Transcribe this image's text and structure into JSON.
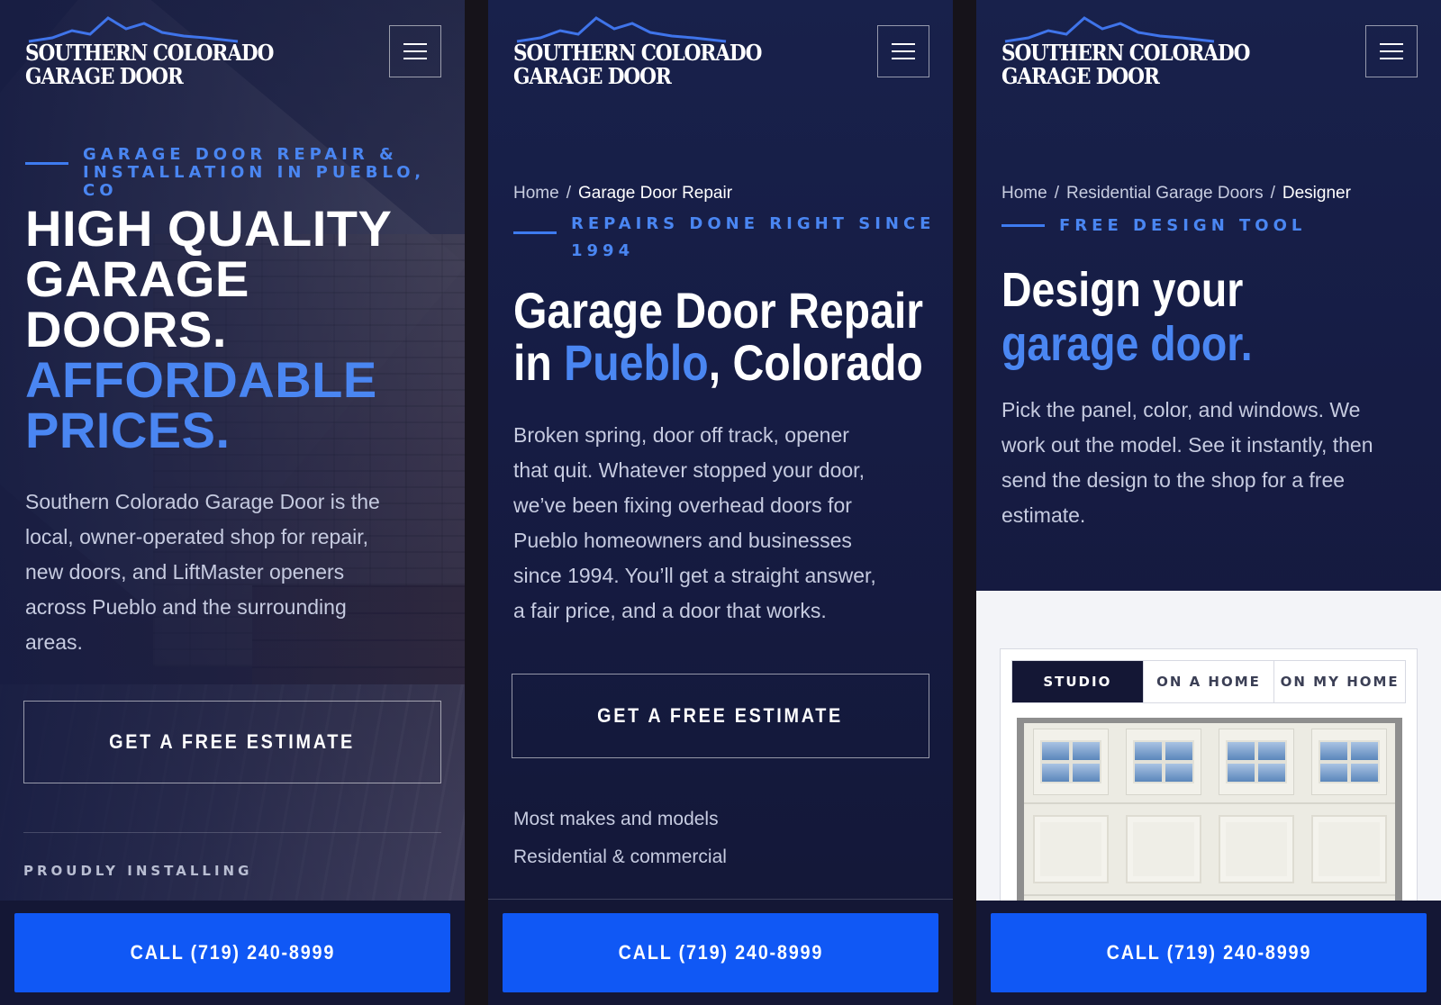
{
  "brand": {
    "logo_line1": "SOUTHERN COLORADO",
    "logo_line2": "GARAGE DOOR"
  },
  "menu_icon": "hamburger-menu-icon",
  "colors": {
    "background": "#161c44",
    "accent": "#4a86f2",
    "call_bar": "#1058f5",
    "active_tab": "#141735"
  },
  "call_bar": {
    "label": "CALL (719) 240-8999"
  },
  "panel1": {
    "eyebrow_line1": "GARAGE DOOR REPAIR &",
    "eyebrow_line2": "INSTALLATION IN PUEBLO, CO",
    "headline": [
      "HIGH QUALITY",
      "GARAGE",
      "DOORS."
    ],
    "headline_accent": [
      "AFFORDABLE",
      "PRICES."
    ],
    "body_lines": [
      "Southern Colorado Garage Door is the",
      "local, owner-operated shop for repair,",
      "new doors, and LiftMaster openers",
      "across Pueblo and the surrounding",
      "areas."
    ],
    "cta": "GET A FREE ESTIMATE",
    "proudly": "PROUDLY INSTALLING"
  },
  "panel2": {
    "breadcrumb": {
      "home": "Home",
      "sep": "/",
      "current": "Garage Door Repair"
    },
    "eyebrow_line1": "REPAIRS DONE RIGHT SINCE",
    "eyebrow_line2": "1994",
    "title_line1": "Garage Door Repair",
    "title_in": "in ",
    "title_accent": "Pueblo",
    "title_rest": ", Colorado",
    "body_lines": [
      "Broken spring, door off track, opener",
      "that quit. Whatever stopped your door,",
      "we’ve been fixing overhead doors for",
      "Pueblo homeowners and businesses",
      "since 1994. You’ll get a straight answer,",
      "a fair price, and a door that works."
    ],
    "cta": "GET A FREE ESTIMATE",
    "features": [
      "Most makes and models",
      "Residential & commercial"
    ]
  },
  "panel3": {
    "breadcrumb": {
      "home": "Home",
      "sep": "/",
      "middle": "Residential Garage Doors",
      "current": "Designer"
    },
    "eyebrow": "FREE DESIGN TOOL",
    "title_line1": "Design your",
    "title_accent": "garage door.",
    "body_lines": [
      "Pick the panel, color, and windows. We",
      "work out the model. See it instantly, then",
      "send the design to the shop for a free",
      "estimate."
    ],
    "tabs": [
      "STUDIO",
      "ON A HOME",
      "ON MY HOME"
    ],
    "active_tab": "STUDIO"
  }
}
